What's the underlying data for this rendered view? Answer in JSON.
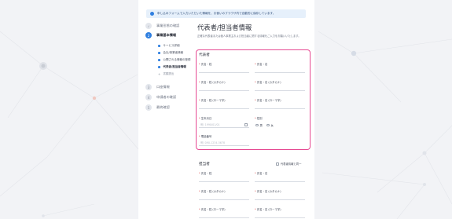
{
  "notice": {
    "text": "申し込みフォームで入力いただいた情報を、お使いのブラウザ内で自動的に保存しています。"
  },
  "steps": [
    {
      "num": "✓",
      "label": "事業形態の確認",
      "state": "done"
    },
    {
      "num": "2",
      "label": "事業基本情報",
      "state": "active"
    },
    {
      "num": "3",
      "label": "口座情報",
      "state": "todo"
    },
    {
      "num": "4",
      "label": "申請者の確認",
      "state": "todo"
    },
    {
      "num": "5",
      "label": "最終確認",
      "state": "todo"
    }
  ],
  "substeps": [
    {
      "label": "サービス詳細",
      "state": "normal"
    },
    {
      "label": "会社/事業者情報",
      "state": "normal"
    },
    {
      "label": "公開される情報の登録",
      "state": "normal"
    },
    {
      "label": "代表者/担当者情報",
      "state": "current"
    },
    {
      "label": "書類提出",
      "state": "muted"
    }
  ],
  "main": {
    "title": "代表者/担当者情報",
    "description": "正確な代表者または個人事業主および担当者に関する情報をご入力をお願いいたします。"
  },
  "representative": {
    "title": "代表者",
    "fields": {
      "last_name": "氏名・姓",
      "first_name": "氏名・名",
      "last_kana": "氏名・姓 (カタカナ)",
      "first_kana": "氏名・名 (カタカナ)",
      "last_roman": "氏名・姓 (ローマ字)",
      "first_roman": "氏名・名 (ローマ字)",
      "birthdate": "生年月日",
      "gender": "性別",
      "phone": "電話番号"
    },
    "birthdate_placeholder": "例) 1990/01/01",
    "phone_placeholder": "例) 090-1234-5678",
    "gender_options": [
      "男",
      "女"
    ]
  },
  "contact": {
    "title": "担当者",
    "same_as_label": "代表者情報と同一",
    "fields": {
      "last_name": "氏名・姓",
      "first_name": "氏名・名",
      "last_kana": "氏名・姓 (カタカナ)",
      "first_kana": "氏名・名 (カタカナ)",
      "last_roman": "氏名・姓 (ローマ字)",
      "first_roman": "氏名・名 (ローマ字)"
    }
  },
  "colors": {
    "accent": "#2f7fe0",
    "highlight_border": "#e64a93",
    "required": "#e24b4b"
  }
}
